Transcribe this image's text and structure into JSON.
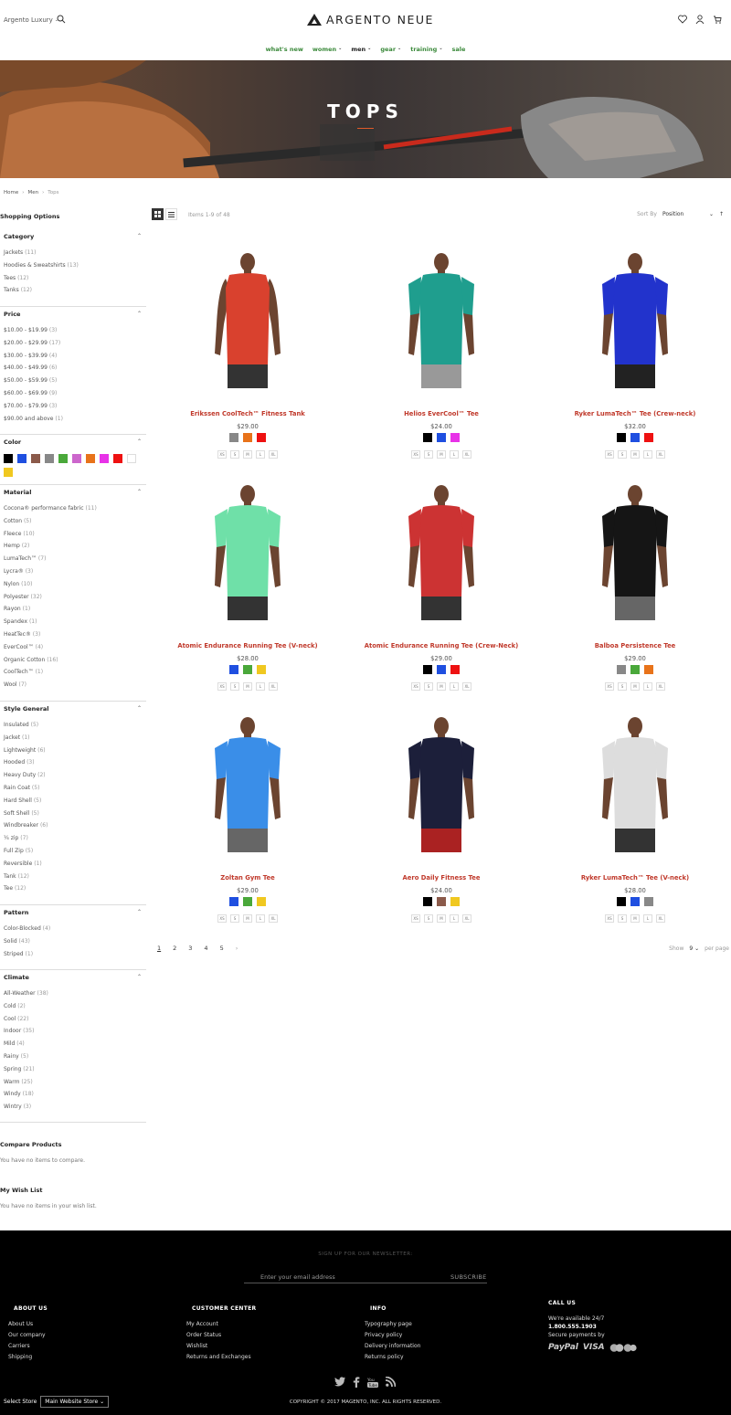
{
  "header": {
    "store_switcher": "Argento Luxury",
    "logo": "ARGENTO NEUE",
    "nav": [
      "what's new",
      "women",
      "men",
      "gear",
      "training",
      "sale"
    ]
  },
  "hero": {
    "title": "TOPS"
  },
  "breadcrumb": [
    "Home",
    "Men",
    "Tops"
  ],
  "sidebar": {
    "title": "Shopping Options",
    "filters": [
      {
        "name": "Category",
        "items": [
          [
            "Jackets",
            "(11)"
          ],
          [
            "Hoodies & Sweatshirts",
            "(13)"
          ],
          [
            "Tees",
            "(12)"
          ],
          [
            "Tanks",
            "(12)"
          ]
        ]
      },
      {
        "name": "Price",
        "items": [
          [
            "$10.00 - $19.99",
            "(3)"
          ],
          [
            "$20.00 - $29.99",
            "(17)"
          ],
          [
            "$30.00 - $39.99",
            "(4)"
          ],
          [
            "$40.00 - $49.99",
            "(6)"
          ],
          [
            "$50.00 - $59.99",
            "(5)"
          ],
          [
            "$60.00 - $69.99",
            "(9)"
          ],
          [
            "$70.00 - $79.99",
            "(3)"
          ],
          [
            "$90.00 and above",
            "(1)"
          ]
        ]
      },
      {
        "name": "Color",
        "swatches": [
          "#000000",
          "#1f4fe0",
          "#8b5a4a",
          "#888888",
          "#4aa83a",
          "#cc66cc",
          "#e8731a",
          "#e832e8",
          "#ee1111",
          "#ffffff",
          "#f0c820"
        ]
      },
      {
        "name": "Material",
        "items": [
          [
            "Cocona® performance fabric",
            "(11)"
          ],
          [
            "Cotton",
            "(5)"
          ],
          [
            "Fleece",
            "(10)"
          ],
          [
            "Hemp",
            "(2)"
          ],
          [
            "LumaTech™",
            "(7)"
          ],
          [
            "Lycra®",
            "(3)"
          ],
          [
            "Nylon",
            "(10)"
          ],
          [
            "Polyester",
            "(32)"
          ],
          [
            "Rayon",
            "(1)"
          ],
          [
            "Spandex",
            "(1)"
          ],
          [
            "HeatTec®",
            "(3)"
          ],
          [
            "EverCool™",
            "(4)"
          ],
          [
            "Organic Cotton",
            "(16)"
          ],
          [
            "CoolTech™",
            "(1)"
          ],
          [
            "Wool",
            "(7)"
          ]
        ]
      },
      {
        "name": "Style General",
        "items": [
          [
            "Insulated",
            "(5)"
          ],
          [
            "Jacket",
            "(1)"
          ],
          [
            "Lightweight",
            "(6)"
          ],
          [
            "Hooded",
            "(3)"
          ],
          [
            "Heavy Duty",
            "(2)"
          ],
          [
            "Rain Coat",
            "(5)"
          ],
          [
            "Hard Shell",
            "(5)"
          ],
          [
            "Soft Shell",
            "(5)"
          ],
          [
            "Windbreaker",
            "(6)"
          ],
          [
            "¼ zip",
            "(7)"
          ],
          [
            "Full Zip",
            "(5)"
          ],
          [
            "Reversible",
            "(1)"
          ],
          [
            "Tank",
            "(12)"
          ],
          [
            "Tee",
            "(12)"
          ]
        ]
      },
      {
        "name": "Pattern",
        "items": [
          [
            "Color-Blocked",
            "(4)"
          ],
          [
            "Solid",
            "(43)"
          ],
          [
            "Striped",
            "(1)"
          ]
        ]
      },
      {
        "name": "Climate",
        "items": [
          [
            "All-Weather",
            "(38)"
          ],
          [
            "Cold",
            "(2)"
          ],
          [
            "Cool",
            "(22)"
          ],
          [
            "Indoor",
            "(35)"
          ],
          [
            "Mild",
            "(4)"
          ],
          [
            "Rainy",
            "(5)"
          ],
          [
            "Spring",
            "(21)"
          ],
          [
            "Warm",
            "(25)"
          ],
          [
            "Windy",
            "(18)"
          ],
          [
            "Wintry",
            "(3)"
          ]
        ]
      }
    ],
    "compare_title": "Compare Products",
    "compare_text": "You have no items to compare.",
    "wishlist_title": "My Wish List",
    "wishlist_text": "You have no items in your wish list."
  },
  "toolbar": {
    "amount": "Items 1-9 of 48",
    "sort_label": "Sort By",
    "sort_value": "Position"
  },
  "products": [
    {
      "name": "Erikssen CoolTech™ Fitness Tank",
      "price": "$29.00",
      "shirt": "#d9412e",
      "tank": true,
      "pants": "#333",
      "colors": [
        "#888888",
        "#e8731a",
        "#ee1111"
      ],
      "sizes": [
        "XS",
        "S",
        "M",
        "L",
        "XL"
      ]
    },
    {
      "name": "Helios EverCool™ Tee",
      "price": "$24.00",
      "shirt": "#1f9e8e",
      "tank": false,
      "pants": "#999",
      "colors": [
        "#000000",
        "#1f4fe0",
        "#e832e8"
      ],
      "sizes": [
        "XS",
        "S",
        "M",
        "L",
        "XL"
      ]
    },
    {
      "name": "Ryker LumaTech™ Tee (Crew-neck)",
      "price": "$32.00",
      "shirt": "#2233cc",
      "tank": false,
      "pants": "#222",
      "colors": [
        "#000000",
        "#1f4fe0",
        "#ee1111"
      ],
      "sizes": [
        "XS",
        "S",
        "M",
        "L",
        "XL"
      ]
    },
    {
      "name": "Atomic Endurance Running Tee (V-neck)",
      "price": "$28.00",
      "shirt": "#6fe0a8",
      "tank": false,
      "pants": "#333",
      "colors": [
        "#1f4fe0",
        "#4aa83a",
        "#f0c820"
      ],
      "sizes": [
        "XS",
        "S",
        "M",
        "L",
        "XL"
      ]
    },
    {
      "name": "Atomic Endurance Running Tee (Crew-Neck)",
      "price": "$29.00",
      "shirt": "#cc3333",
      "tank": false,
      "pants": "#333",
      "colors": [
        "#000000",
        "#1f4fe0",
        "#ee1111"
      ],
      "sizes": [
        "XS",
        "S",
        "M",
        "L",
        "XL"
      ]
    },
    {
      "name": "Balboa Persistence Tee",
      "price": "$29.00",
      "shirt": "#151515",
      "tank": false,
      "pants": "#666",
      "colors": [
        "#888888",
        "#4aa83a",
        "#e8731a"
      ],
      "sizes": [
        "XS",
        "S",
        "M",
        "L",
        "XL"
      ]
    },
    {
      "name": "Zoltan Gym Tee",
      "price": "$29.00",
      "shirt": "#3a8ee8",
      "tank": false,
      "pants": "#666",
      "colors": [
        "#1f4fe0",
        "#4aa83a",
        "#f0c820"
      ],
      "sizes": [
        "XS",
        "S",
        "M",
        "L",
        "XL"
      ]
    },
    {
      "name": "Aero Daily Fitness Tee",
      "price": "$24.00",
      "shirt": "#1c1f3a",
      "tank": false,
      "pants": "#aa2222",
      "colors": [
        "#000000",
        "#8b5a4a",
        "#f0c820"
      ],
      "sizes": [
        "XS",
        "S",
        "M",
        "L",
        "XL"
      ]
    },
    {
      "name": "Ryker LumaTech™ Tee (V-neck)",
      "price": "$28.00",
      "shirt": "#dddddd",
      "tank": false,
      "pants": "#333",
      "colors": [
        "#000000",
        "#1f4fe0",
        "#888888"
      ],
      "sizes": [
        "XS",
        "S",
        "M",
        "L",
        "XL"
      ]
    }
  ],
  "pager": {
    "pages": [
      "1",
      "2",
      "3",
      "4",
      "5"
    ],
    "next": "›",
    "show_label": "Show",
    "per_page_value": "9",
    "per_page_label": "per page"
  },
  "footer": {
    "newsletter_title": "SIGN UP FOR OUR NEWSLETTER:",
    "email_placeholder": "Enter your email address",
    "subscribe": "SUBSCRIBE",
    "about_title": "ABOUT US",
    "about_links": [
      "About Us",
      "Our company",
      "Carriers",
      "Shipping"
    ],
    "customer_title": "CUSTOMER CENTER",
    "customer_links": [
      "My Account",
      "Order Status",
      "Wishlist",
      "Returns and Exchanges"
    ],
    "info_title": "INFO",
    "info_links": [
      "Typography page",
      "Privacy policy",
      "Delivery information",
      "Returns policy"
    ],
    "call_title": "CALL US",
    "call_available": "We're available 24/7",
    "call_phone": "1.800.555.1903",
    "secure": "Secure payments by",
    "paypal": "PayPal",
    "visa": "VISA",
    "select_store_label": "Select Store",
    "select_store_value": "Main Website Store",
    "copyright": "COPYRIGHT © 2017 MAGENTO, INC. ALL RIGHTS RESERVED."
  }
}
